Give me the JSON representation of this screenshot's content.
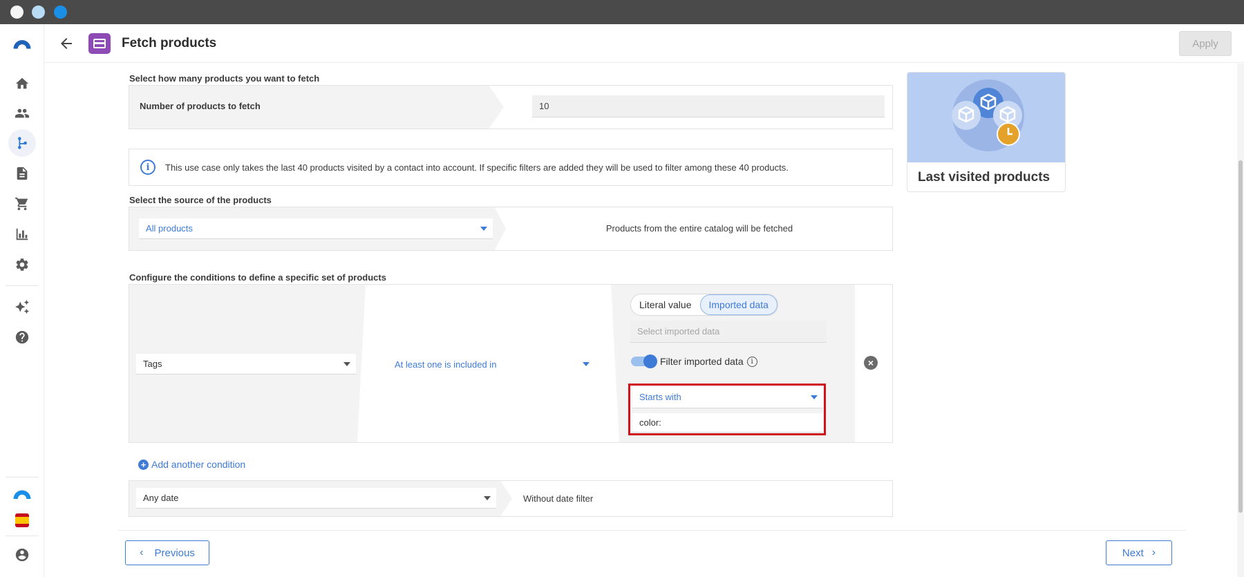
{
  "header": {
    "title": "Fetch products",
    "apply_label": "Apply"
  },
  "fetch": {
    "section_label": "Select how many products you want to fetch",
    "field_label": "Number of products to fetch",
    "value": "10"
  },
  "info": {
    "text": "This use case only takes the last 40 products visited by a contact into account. If specific filters are added they will be used to filter among these 40 products."
  },
  "source": {
    "section_label": "Select the source of the products",
    "selected": "All products",
    "description": "Products from the entire catalog will be fetched"
  },
  "conditions": {
    "section_label": "Configure the conditions to define a specific set of products",
    "field": "Tags",
    "operator": "At least one is included in",
    "value_modes": [
      "Literal value",
      "Imported data"
    ],
    "imported_placeholder": "Select imported data",
    "filter_label": "Filter imported data",
    "filter_operator": "Starts with",
    "filter_value": "color:",
    "add_label": "Add another condition"
  },
  "date": {
    "selected": "Any date",
    "description": "Without date filter"
  },
  "footer": {
    "previous_label": "Previous",
    "next_label": "Next"
  },
  "card": {
    "title": "Last visited products"
  },
  "colors": {
    "accent": "#3d7bd6",
    "highlight": "#d0121b",
    "app_icon": "#8e4bb5"
  },
  "sidebar": {
    "icons": [
      "brand-logo-icon",
      "home-icon",
      "contacts-icon",
      "workflow-icon",
      "document-icon",
      "cart-icon",
      "chart-icon",
      "settings-icon",
      "sparkle-icon",
      "help-icon",
      "account-logo-icon",
      "spain-flag-icon",
      "user-icon"
    ]
  }
}
